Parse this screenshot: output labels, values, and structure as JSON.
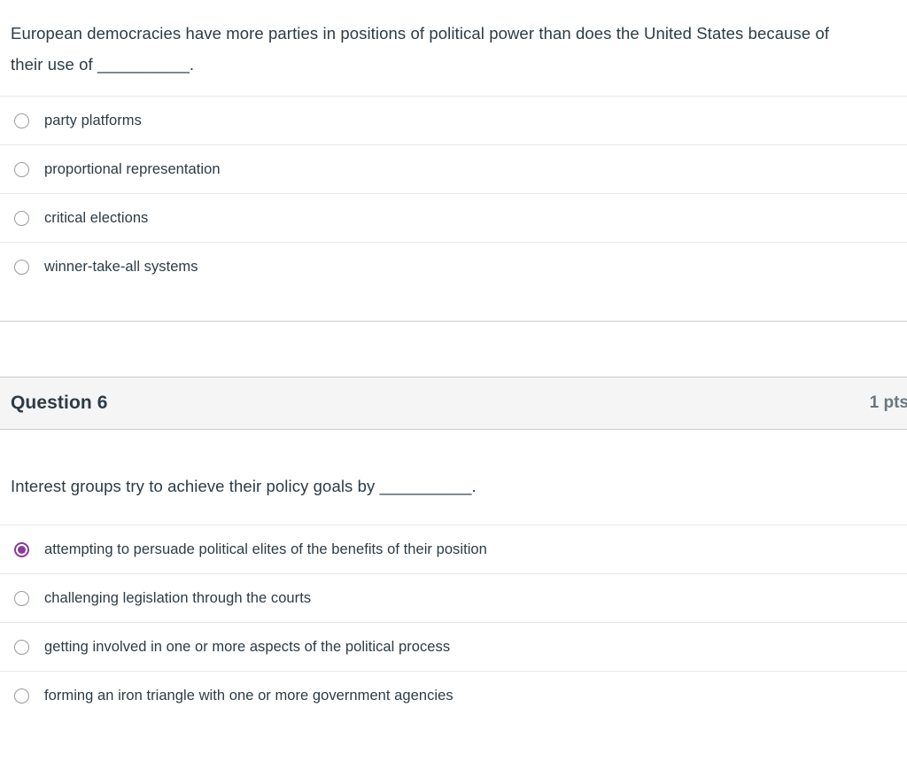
{
  "quiz": {
    "questions": [
      {
        "id": "question-5-continued",
        "header_visible": false,
        "name": "",
        "points": "",
        "text": "European democracies have more parties in positions of political power than does the United States because of their use of __________.",
        "answers": [
          {
            "label": "party platforms",
            "selected": false
          },
          {
            "label": "proportional representation",
            "selected": false
          },
          {
            "label": "critical elections",
            "selected": false
          },
          {
            "label": "winner-take-all systems",
            "selected": false
          }
        ]
      },
      {
        "id": "question-6",
        "header_visible": true,
        "name": "Question 6",
        "points": "1 pts",
        "text": "Interest groups try to achieve their policy goals by __________.",
        "answers": [
          {
            "label": "attempting to persuade political elites of the benefits of their position",
            "selected": true
          },
          {
            "label": "challenging legislation through the courts",
            "selected": false
          },
          {
            "label": "getting involved in one or more aspects of the political process",
            "selected": false
          },
          {
            "label": "forming an iron triangle with one or more government agencies",
            "selected": false
          }
        ]
      }
    ]
  },
  "colors": {
    "selected_radio": "#8b3a9c",
    "unselected_radio_border": "#9b9b9b",
    "header_background": "#f5f5f5",
    "header_border": "#c7cdd1",
    "row_divider": "#e9e9e9",
    "text": "#2d3b45",
    "points_text": "#6b7780"
  }
}
